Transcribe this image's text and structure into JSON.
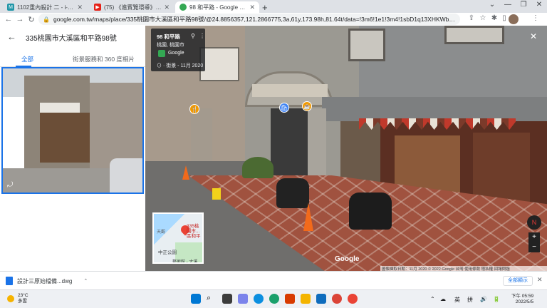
{
  "browser": {
    "tabs": [
      {
        "label": "1102重內殺計 二 - i-learning平...",
        "icon": "m-icon",
        "color": "#2196a8",
        "glyph": "M"
      },
      {
        "label": "(75) 《進賓覽環導》EP15 一券...",
        "icon": "youtube-icon",
        "color": "#e62117",
        "glyph": "▶"
      },
      {
        "label": "98 和平路 - Google 地圖",
        "icon": "maps-icon",
        "color": "#34a853",
        "glyph": "⬤"
      }
    ],
    "new_tab": "+",
    "window_controls": [
      "⌄",
      "—",
      "❐",
      "✕"
    ],
    "url": "google.com.tw/maps/place/335桃園市大溪區和平路98號/@24.8856357,121.2866775,3a,61y,173.98h,81.64t/data=!3m6!1e1!3m4!1sbD1q13XHKWbNYME-vTkj7g!2e0!7i1...",
    "toolbar_icons": [
      "share-icon",
      "star-icon",
      "extensions-icon",
      "sidebar-icon"
    ],
    "menu": "⋮"
  },
  "panel": {
    "back": "←",
    "title": "335桃園市大溪區和平路98號",
    "tabs": [
      {
        "label": "全部",
        "active": true
      },
      {
        "label": "街景服務和 360 度相片",
        "active": false
      }
    ],
    "pano_icon": "⤾"
  },
  "streetview": {
    "card": {
      "title": "98 和平路",
      "subtitle": "桃園, 桃園市",
      "source": "Google",
      "capture": "⊙ · 街景 - 11月 2020"
    },
    "close": "✕",
    "minimap": {
      "pin_label": "335桃園市...",
      "pin_label2": "區和平",
      "l2": "天觀",
      "l3": "中正公園",
      "l4": "藝術館 - 大溪"
    },
    "compass": "N",
    "zoom_in": "+",
    "zoom_out": "−",
    "watermark": "Google",
    "attribution": "圖像擷取日期：11月 2020  © 2022 Google  台灣  使用條款  隱私權  回報問題"
  },
  "downloads": {
    "file": "設計三原始檔備...dwg",
    "caret": "⌃",
    "show_all": "全部顯示",
    "close": "✕"
  },
  "taskbar": {
    "weather_temp": "23°C",
    "weather_desc": "多雲",
    "apps": [
      "windows-icon",
      "search-icon",
      "file-explorer-icon",
      "teams-icon",
      "edge-icon",
      "edge-alt-icon",
      "office-icon",
      "folder-icon",
      "mail-icon",
      "chrome-icon",
      "app-icon"
    ],
    "tray": [
      "⌃",
      "☁",
      "英",
      "拼",
      "🔊",
      "🔋"
    ],
    "time": "下午 05:59",
    "date": "2022/5/5"
  }
}
